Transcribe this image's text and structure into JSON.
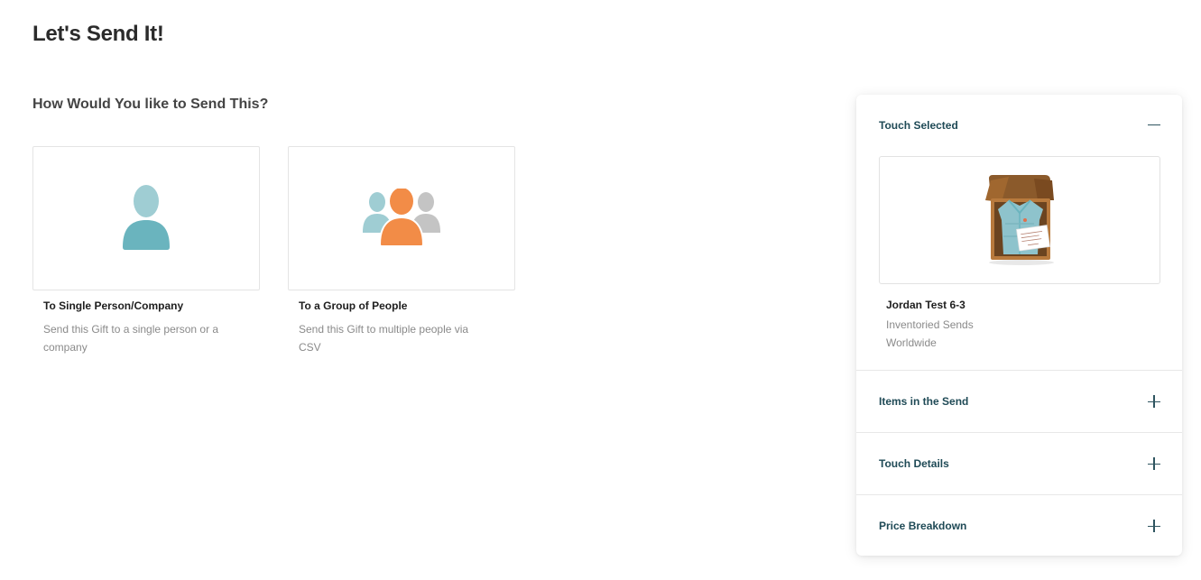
{
  "page": {
    "title": "Let's Send It!",
    "section_heading": "How Would You like to Send This?"
  },
  "options": [
    {
      "title": "To Single Person/Company",
      "description": "Send this Gift to a single person or a company",
      "icon": "single-person-icon"
    },
    {
      "title": "To a Group of People",
      "description": "Send this Gift to multiple people via CSV",
      "icon": "group-people-icon"
    }
  ],
  "panel": {
    "touch_selected": {
      "label": "Touch Selected",
      "state": "expanded",
      "toggle_icon": "minus-icon",
      "image": "gift-box-image",
      "name": "Jordan Test 6-3",
      "type": "Inventoried Sends",
      "region": "Worldwide"
    },
    "sections": [
      {
        "label": "Items in the Send",
        "toggle_icon": "plus-icon"
      },
      {
        "label": "Touch Details",
        "toggle_icon": "plus-icon"
      },
      {
        "label": "Price Breakdown",
        "toggle_icon": "plus-icon"
      }
    ]
  },
  "colors": {
    "teal_primary": "#6ab4be",
    "teal_light": "#9fcdd3",
    "orange": "#f28c47",
    "grey": "#bdbdbd",
    "panel_label": "#1f4a56"
  }
}
